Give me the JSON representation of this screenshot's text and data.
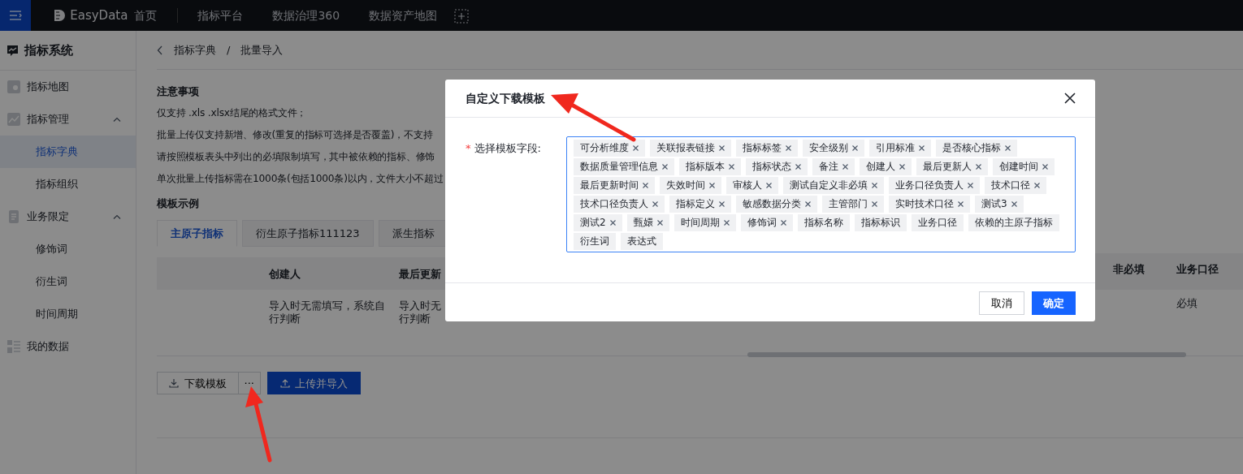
{
  "topbar": {
    "logo": "EasyData",
    "nav": [
      {
        "label": "首页",
        "selected": false
      },
      {
        "label": "指标平台",
        "selected": false
      },
      {
        "label": "数据治理360",
        "selected": false
      },
      {
        "label": "数据资产地图",
        "selected": false
      }
    ]
  },
  "sidebar": {
    "title": "指标系统",
    "items": [
      {
        "label": "指标地图",
        "kind": "map",
        "selected": false
      },
      {
        "label": "指标管理",
        "kind": "chart",
        "expanded": true,
        "selected": false,
        "children": [
          {
            "label": "指标字典",
            "selected": true
          },
          {
            "label": "指标组织",
            "selected": false
          }
        ]
      },
      {
        "label": "业务限定",
        "kind": "doc",
        "expanded": true,
        "selected": false,
        "children": [
          {
            "label": "修饰词",
            "selected": false
          },
          {
            "label": "衍生词",
            "selected": false
          },
          {
            "label": "时间周期",
            "selected": false
          }
        ]
      },
      {
        "label": "我的数据",
        "kind": "grid",
        "selected": false
      }
    ]
  },
  "breadcrumb": [
    "指标字典",
    "批量导入"
  ],
  "breadcrumb_separator": "/",
  "notes": {
    "title": "注意事项",
    "lines": [
      "仅支持 .xls .xlsx结尾的格式文件；",
      "批量上传仅支持新增、修改(重复的指标可选择是否覆盖)，不支持",
      "请按照模板表头中列出的必填限制填写，其中被依赖的指标、修饰",
      "单次批量上传指标需在1000条(包括1000条)以内，文件大小不超过"
    ]
  },
  "example": {
    "title": "模板示例",
    "tabs": [
      {
        "label": "主原子指标",
        "selected": true
      },
      {
        "label": "衍生原子指标111123",
        "selected": false
      },
      {
        "label": "派生指标",
        "selected": false
      }
    ],
    "columns_left": [
      {
        "header": "创建人",
        "cell": [
          "导入时无需填写，系统自",
          "行判断"
        ]
      },
      {
        "header": "最后更新",
        "cell": [
          "导入时无",
          "行判断"
        ]
      }
    ],
    "columns_right": [
      {
        "header": "非必填"
      },
      {
        "header": "业务口径",
        "cell": "必填"
      }
    ]
  },
  "actions": {
    "download": "下载模板",
    "more": "···",
    "upload": "上传并导入"
  },
  "modal": {
    "title": "自定义下载模板",
    "field_label": "选择模板字段:",
    "required_mark": "*",
    "tags": [
      {
        "label": "可分析维度",
        "closable": true
      },
      {
        "label": "关联报表链接",
        "closable": true
      },
      {
        "label": "指标标签",
        "closable": true
      },
      {
        "label": "安全级别",
        "closable": true
      },
      {
        "label": "引用标准",
        "closable": true
      },
      {
        "label": "是否核心指标",
        "closable": true
      },
      {
        "label": "数据质量管理信息",
        "closable": true
      },
      {
        "label": "指标版本",
        "closable": true
      },
      {
        "label": "指标状态",
        "closable": true
      },
      {
        "label": "备注",
        "closable": true
      },
      {
        "label": "创建人",
        "closable": true
      },
      {
        "label": "最后更新人",
        "closable": true
      },
      {
        "label": "创建时间",
        "closable": true
      },
      {
        "label": "最后更新时间",
        "closable": true
      },
      {
        "label": "失效时间",
        "closable": true
      },
      {
        "label": "审核人",
        "closable": true
      },
      {
        "label": "测试自定义非必填",
        "closable": true
      },
      {
        "label": "业务口径负责人",
        "closable": true
      },
      {
        "label": "技术口径",
        "closable": true
      },
      {
        "label": "技术口径负责人",
        "closable": true
      },
      {
        "label": "指标定义",
        "closable": true
      },
      {
        "label": "敏感数据分类",
        "closable": true
      },
      {
        "label": "主管部门",
        "closable": true
      },
      {
        "label": "实时技术口径",
        "closable": true
      },
      {
        "label": "测试3",
        "closable": true
      },
      {
        "label": "测试2",
        "closable": true
      },
      {
        "label": "甄嬛",
        "closable": true
      },
      {
        "label": "时间周期",
        "closable": true
      },
      {
        "label": "修饰词",
        "closable": true
      },
      {
        "label": "指标名称",
        "closable": false
      },
      {
        "label": "指标标识",
        "closable": false
      },
      {
        "label": "业务口径",
        "closable": false
      },
      {
        "label": "依赖的主原子指标",
        "closable": false
      },
      {
        "label": "衍生词",
        "closable": false
      },
      {
        "label": "表达式",
        "closable": false
      }
    ],
    "cancel": "取消",
    "ok": "确定"
  }
}
